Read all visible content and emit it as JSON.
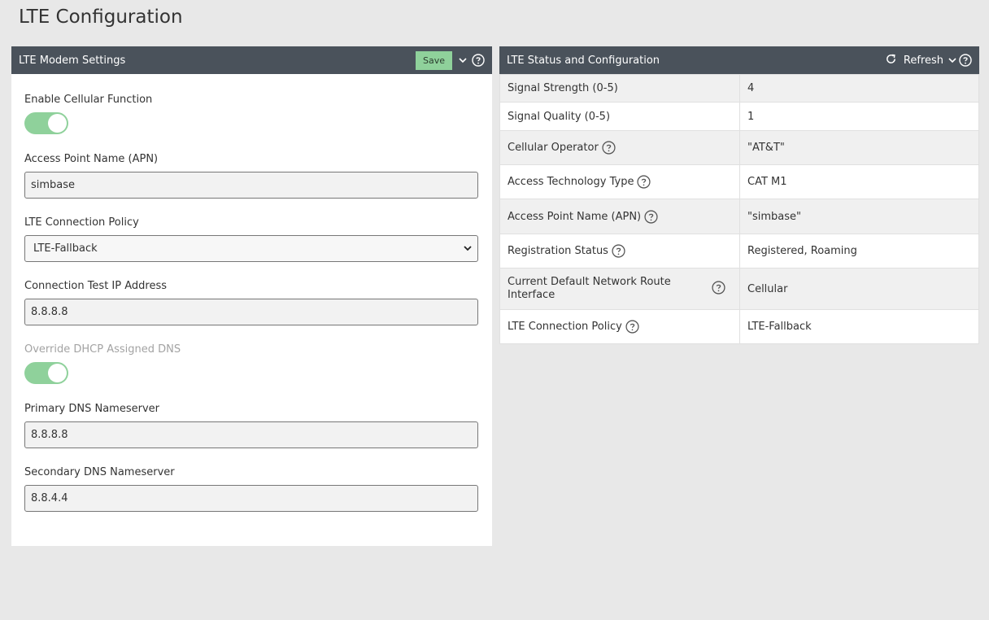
{
  "page": {
    "title": "LTE Configuration"
  },
  "left_panel": {
    "title": "LTE Modem Settings",
    "save_label": "Save",
    "fields": {
      "enable_cellular": {
        "label": "Enable Cellular Function",
        "on": true
      },
      "apn": {
        "label": "Access Point Name (APN)",
        "value": "simbase"
      },
      "policy": {
        "label": "LTE Connection Policy",
        "value": "LTE-Fallback"
      },
      "test_ip": {
        "label": "Connection Test IP Address",
        "value": "8.8.8.8"
      },
      "override_dns": {
        "label": "Override DHCP Assigned DNS",
        "on": true
      },
      "primary_dns": {
        "label": "Primary DNS Nameserver",
        "value": "8.8.8.8"
      },
      "secondary_dns": {
        "label": "Secondary DNS Nameserver",
        "value": "8.8.4.4"
      }
    }
  },
  "right_panel": {
    "title": "LTE Status and Configuration",
    "refresh_label": "Refresh",
    "rows": [
      {
        "key": "Signal Strength (0-5)",
        "value": "4",
        "help": false
      },
      {
        "key": "Signal Quality (0-5)",
        "value": "1",
        "help": false
      },
      {
        "key": "Cellular Operator",
        "value": "\"AT&T\"",
        "help": true
      },
      {
        "key": "Access Technology Type",
        "value": "CAT M1",
        "help": true
      },
      {
        "key": "Access Point Name (APN)",
        "value": "\"simbase\"",
        "help": true
      },
      {
        "key": "Registration Status",
        "value": "Registered, Roaming",
        "help": true
      },
      {
        "key": "Current Default Network Route Interface",
        "value": "Cellular",
        "help": true
      },
      {
        "key": "LTE Connection Policy",
        "value": "LTE-Fallback",
        "help": true
      }
    ]
  },
  "colors": {
    "header_bg": "#4a525b",
    "accent_green": "#8fd19b",
    "page_bg": "#e8e8e8"
  },
  "icons": {
    "help": "question-circle-icon",
    "chevron": "chevron-down-icon",
    "refresh": "refresh-icon"
  }
}
